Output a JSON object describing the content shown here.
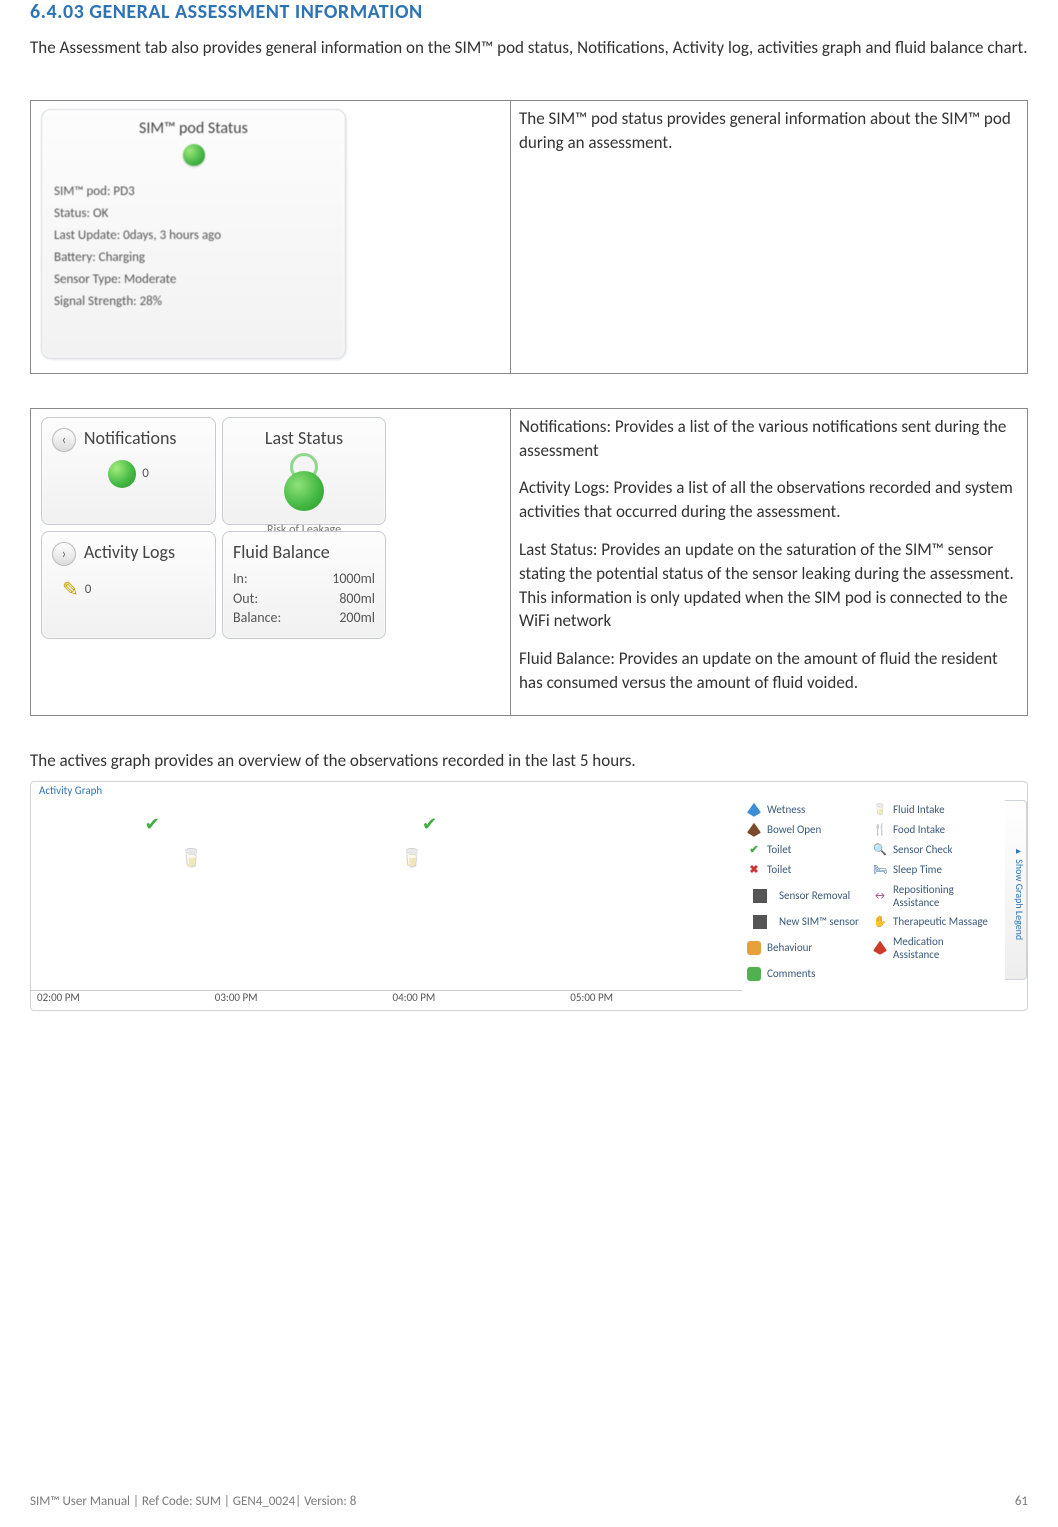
{
  "heading": "6.4.03 GENERAL ASSESSMENT INFORMATION",
  "intro": "The Assessment tab also provides general information on the SIM™ pod status, Notifications, Activity log, activities graph and fluid balance chart.",
  "status_panel": {
    "title": "SIM™ pod   Status",
    "lines": {
      "pod": "SIM™ pod: PD3",
      "status": "Status: OK",
      "last_update": "Last Update:    0days, 3 hours ago",
      "battery": "Battery: Charging",
      "sensor_type": "Sensor Type: Moderate",
      "signal": "Signal Strength: 28%"
    }
  },
  "status_desc": "The SIM™  pod status provides general information about the SIM™ pod during an assessment.",
  "tiles": {
    "notifications_label": "Notifications",
    "notifications_count": "0",
    "activity_logs_label": "Activity Logs",
    "activity_logs_count": "0",
    "last_status_label": "Last Status",
    "risk_label": "Risk of Leakage",
    "fluid_balance_label": "Fluid Balance",
    "fb_in_label": "In:",
    "fb_in_val": "1000ml",
    "fb_out_label": "Out:",
    "fb_out_val": "800ml",
    "fb_bal_label": "Balance:",
    "fb_bal_val": "200ml"
  },
  "tiles_desc": {
    "p1": "Notifications: Provides a list of the various notifications sent during the assessment",
    "p2": "Activity Logs: Provides a list of all the observations recorded and system activities that occurred during the assessment.",
    "p3": "Last Status: Provides an update on the saturation of the SIM™ sensor stating the potential status of the sensor leaking during the assessment. This information is only updated when the SIM pod is connected to the WiFi network",
    "p4": "Fluid Balance: Provides an update on the amount of fluid the resident has consumed versus the amount of fluid voided."
  },
  "actives_text": "The actives graph provides an overview of the observations recorded in the last 5 hours.",
  "activity_graph": {
    "title": "Activity Graph",
    "xaxis": [
      "02:00 PM",
      "03:00 PM",
      "04:00 PM",
      "05:00 PM"
    ],
    "legend": [
      {
        "icon": "drop-blue",
        "label": "Wetness"
      },
      {
        "icon": "cupic",
        "label": "Fluid Intake"
      },
      {
        "icon": "drop-brown",
        "label": "Bowel Open"
      },
      {
        "icon": "fork",
        "label": "Food Intake"
      },
      {
        "icon": "chk",
        "label": "Toilet"
      },
      {
        "icon": "srch",
        "label": "Sensor Check"
      },
      {
        "icon": "xx",
        "label": "Toilet"
      },
      {
        "icon": "sleep",
        "label": "Sleep Time"
      },
      {
        "icon": "bar",
        "label": "Sensor Removal"
      },
      {
        "icon": "repos",
        "label": "Repositioning Assistance"
      },
      {
        "icon": "bar",
        "label": "New SIM™ sensor"
      },
      {
        "icon": "mass",
        "label": "Therapeutic Massage"
      },
      {
        "icon": "beh",
        "label": "Behaviour"
      },
      {
        "icon": "med",
        "label": "Medication Assistance"
      },
      {
        "icon": "cmt",
        "label": "Comments"
      }
    ],
    "side_tab": "▸ Show Graph Legend"
  },
  "footer": {
    "left": "SIM™ User Manual | Ref Code: SUM | GEN4_0024| Version: 8",
    "page": "61"
  }
}
